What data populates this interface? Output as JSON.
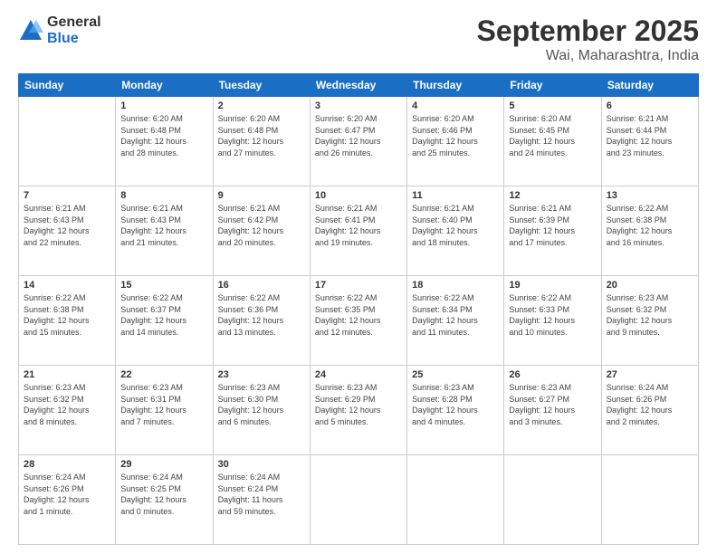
{
  "logo": {
    "general": "General",
    "blue": "Blue"
  },
  "title": {
    "month": "September 2025",
    "location": "Wai, Maharashtra, India"
  },
  "headers": [
    "Sunday",
    "Monday",
    "Tuesday",
    "Wednesday",
    "Thursday",
    "Friday",
    "Saturday"
  ],
  "weeks": [
    [
      {
        "day": "",
        "info": ""
      },
      {
        "day": "1",
        "info": "Sunrise: 6:20 AM\nSunset: 6:48 PM\nDaylight: 12 hours\nand 28 minutes."
      },
      {
        "day": "2",
        "info": "Sunrise: 6:20 AM\nSunset: 6:48 PM\nDaylight: 12 hours\nand 27 minutes."
      },
      {
        "day": "3",
        "info": "Sunrise: 6:20 AM\nSunset: 6:47 PM\nDaylight: 12 hours\nand 26 minutes."
      },
      {
        "day": "4",
        "info": "Sunrise: 6:20 AM\nSunset: 6:46 PM\nDaylight: 12 hours\nand 25 minutes."
      },
      {
        "day": "5",
        "info": "Sunrise: 6:20 AM\nSunset: 6:45 PM\nDaylight: 12 hours\nand 24 minutes."
      },
      {
        "day": "6",
        "info": "Sunrise: 6:21 AM\nSunset: 6:44 PM\nDaylight: 12 hours\nand 23 minutes."
      }
    ],
    [
      {
        "day": "7",
        "info": "Sunrise: 6:21 AM\nSunset: 6:43 PM\nDaylight: 12 hours\nand 22 minutes."
      },
      {
        "day": "8",
        "info": "Sunrise: 6:21 AM\nSunset: 6:43 PM\nDaylight: 12 hours\nand 21 minutes."
      },
      {
        "day": "9",
        "info": "Sunrise: 6:21 AM\nSunset: 6:42 PM\nDaylight: 12 hours\nand 20 minutes."
      },
      {
        "day": "10",
        "info": "Sunrise: 6:21 AM\nSunset: 6:41 PM\nDaylight: 12 hours\nand 19 minutes."
      },
      {
        "day": "11",
        "info": "Sunrise: 6:21 AM\nSunset: 6:40 PM\nDaylight: 12 hours\nand 18 minutes."
      },
      {
        "day": "12",
        "info": "Sunrise: 6:21 AM\nSunset: 6:39 PM\nDaylight: 12 hours\nand 17 minutes."
      },
      {
        "day": "13",
        "info": "Sunrise: 6:22 AM\nSunset: 6:38 PM\nDaylight: 12 hours\nand 16 minutes."
      }
    ],
    [
      {
        "day": "14",
        "info": "Sunrise: 6:22 AM\nSunset: 6:38 PM\nDaylight: 12 hours\nand 15 minutes."
      },
      {
        "day": "15",
        "info": "Sunrise: 6:22 AM\nSunset: 6:37 PM\nDaylight: 12 hours\nand 14 minutes."
      },
      {
        "day": "16",
        "info": "Sunrise: 6:22 AM\nSunset: 6:36 PM\nDaylight: 12 hours\nand 13 minutes."
      },
      {
        "day": "17",
        "info": "Sunrise: 6:22 AM\nSunset: 6:35 PM\nDaylight: 12 hours\nand 12 minutes."
      },
      {
        "day": "18",
        "info": "Sunrise: 6:22 AM\nSunset: 6:34 PM\nDaylight: 12 hours\nand 11 minutes."
      },
      {
        "day": "19",
        "info": "Sunrise: 6:22 AM\nSunset: 6:33 PM\nDaylight: 12 hours\nand 10 minutes."
      },
      {
        "day": "20",
        "info": "Sunrise: 6:23 AM\nSunset: 6:32 PM\nDaylight: 12 hours\nand 9 minutes."
      }
    ],
    [
      {
        "day": "21",
        "info": "Sunrise: 6:23 AM\nSunset: 6:32 PM\nDaylight: 12 hours\nand 8 minutes."
      },
      {
        "day": "22",
        "info": "Sunrise: 6:23 AM\nSunset: 6:31 PM\nDaylight: 12 hours\nand 7 minutes."
      },
      {
        "day": "23",
        "info": "Sunrise: 6:23 AM\nSunset: 6:30 PM\nDaylight: 12 hours\nand 6 minutes."
      },
      {
        "day": "24",
        "info": "Sunrise: 6:23 AM\nSunset: 6:29 PM\nDaylight: 12 hours\nand 5 minutes."
      },
      {
        "day": "25",
        "info": "Sunrise: 6:23 AM\nSunset: 6:28 PM\nDaylight: 12 hours\nand 4 minutes."
      },
      {
        "day": "26",
        "info": "Sunrise: 6:23 AM\nSunset: 6:27 PM\nDaylight: 12 hours\nand 3 minutes."
      },
      {
        "day": "27",
        "info": "Sunrise: 6:24 AM\nSunset: 6:26 PM\nDaylight: 12 hours\nand 2 minutes."
      }
    ],
    [
      {
        "day": "28",
        "info": "Sunrise: 6:24 AM\nSunset: 6:26 PM\nDaylight: 12 hours\nand 1 minute."
      },
      {
        "day": "29",
        "info": "Sunrise: 6:24 AM\nSunset: 6:25 PM\nDaylight: 12 hours\nand 0 minutes."
      },
      {
        "day": "30",
        "info": "Sunrise: 6:24 AM\nSunset: 6:24 PM\nDaylight: 11 hours\nand 59 minutes."
      },
      {
        "day": "",
        "info": ""
      },
      {
        "day": "",
        "info": ""
      },
      {
        "day": "",
        "info": ""
      },
      {
        "day": "",
        "info": ""
      }
    ]
  ]
}
